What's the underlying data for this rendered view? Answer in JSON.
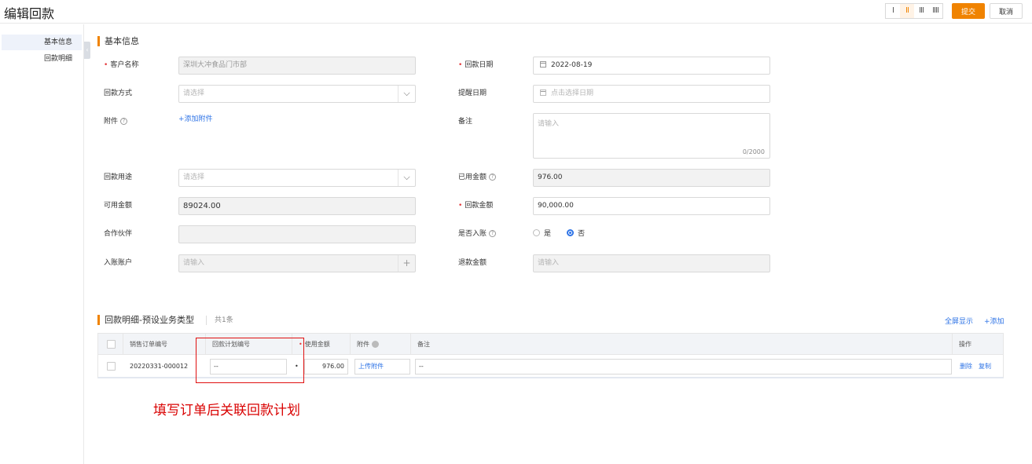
{
  "header": {
    "title": "编辑回款",
    "column_layouts": [
      "I",
      "II",
      "III",
      "IIII"
    ],
    "submit_label": "提交",
    "cancel_label": "取消"
  },
  "left_nav": {
    "items": [
      {
        "label": "基本信息",
        "active": true
      },
      {
        "label": "回款明细",
        "active": false
      }
    ]
  },
  "basic_info": {
    "title": "基本信息",
    "fields": {
      "customer_name": {
        "label": "客户名称",
        "required": true,
        "value": "深圳大冲食品门市部"
      },
      "payment_date": {
        "label": "回款日期",
        "required": true,
        "value": "2022-08-19"
      },
      "payment_method": {
        "label": "回款方式",
        "placeholder": "请选择"
      },
      "reminder_date": {
        "label": "提醒日期",
        "placeholder": "点击选择日期"
      },
      "attachment": {
        "label": "附件",
        "action": "+添加附件"
      },
      "remark": {
        "label": "备注",
        "placeholder": "请输入",
        "counter": "0/2000"
      },
      "payment_usage": {
        "label": "回款用途",
        "placeholder": "请选择"
      },
      "used_amount": {
        "label": "已用金额",
        "value": "976.00"
      },
      "available_amount": {
        "label": "可用金额",
        "value": "89024.00"
      },
      "payment_amount": {
        "label": "回款金额",
        "required": true,
        "value": "90,000.00"
      },
      "partner": {
        "label": "合作伙伴",
        "value": ""
      },
      "is_booked": {
        "label": "是否入账",
        "options": [
          "是",
          "否"
        ],
        "selected": "否"
      },
      "booking_account": {
        "label": "入账账户",
        "placeholder": "请输入"
      },
      "refund_amount": {
        "label": "退款金额",
        "placeholder": "请输入"
      }
    }
  },
  "details": {
    "title": "回款明细-预设业务类型",
    "count": "共1条",
    "fullscreen_label": "全屏显示",
    "add_label": "+添加",
    "columns": [
      "销售订单编号",
      "回款计划编号",
      "使用金额",
      "附件",
      "备注",
      "操作"
    ],
    "rows": [
      {
        "order_no": "20220331-000012",
        "plan_no": "--",
        "amount": "976.00",
        "attachment_action": "上传附件",
        "remark": "--",
        "actions": [
          "删除",
          "复制"
        ]
      }
    ]
  },
  "annotation": {
    "text": "填写订单后关联回款计划",
    "color": "#d90000"
  },
  "colors": {
    "accent": "#f08300",
    "link": "#2f74e6",
    "required": "#e4393c"
  }
}
